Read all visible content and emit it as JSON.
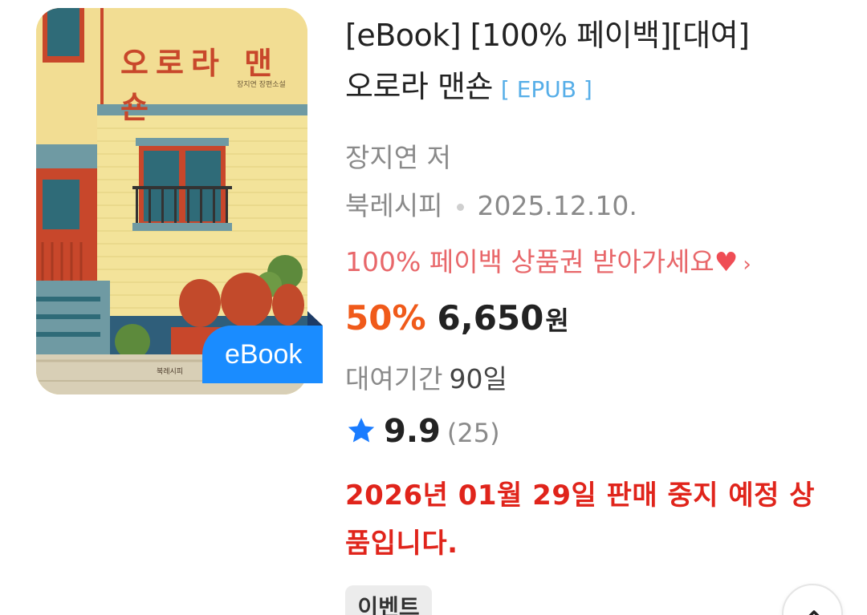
{
  "cover": {
    "title": "오로라 맨숀",
    "subtitle": "장지연 장편소설",
    "publisher": "북레시피",
    "badge": "eBook"
  },
  "product": {
    "title_line1": "[eBook] [100% 페이백][대여]",
    "title_line2": "오로라 맨숀",
    "format_tag": "[ EPUB ]",
    "author": "장지연 저",
    "publisher": "북레시피",
    "publish_date": "2025.12.10.",
    "promo_text": "100% 페이백 상품권 받아가세요",
    "promo_heart": "♥",
    "promo_chevron": "›",
    "discount": "50%",
    "price": "6,650",
    "currency": "원",
    "rental_label": "대여기간",
    "rental_days": "90일",
    "rating": "9.9",
    "review_count": "(25)",
    "notice": "2026년 01월 29일 판매 중지 예정 상품입니다.",
    "event_tag": "이벤트"
  },
  "colors": {
    "discount": "#f05a1a",
    "notice": "#e0241b",
    "promo": "#e8676a",
    "badge": "#1a8cff",
    "star": "#1a7cff",
    "format_tag": "#56aee8"
  },
  "icons": {
    "rating": "star-icon",
    "scroll": "chevron-up-icon"
  }
}
